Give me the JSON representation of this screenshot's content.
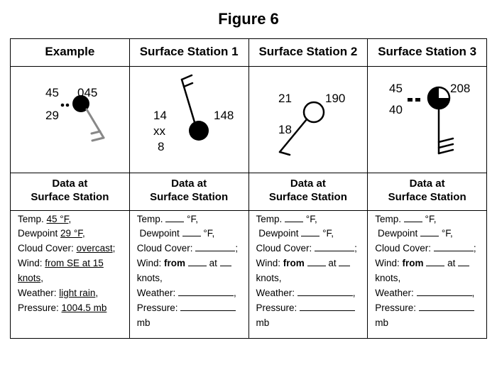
{
  "title": "Figure 6",
  "headers": [
    "Example",
    "Surface Station 1",
    "Surface Station 2",
    "Surface Station 3"
  ],
  "subhead": {
    "line1": "Data at",
    "line2": "Surface Station"
  },
  "example": {
    "model": {
      "temp": "45",
      "pressure_code": "045",
      "dewpoint": "29"
    },
    "data": {
      "temp": "45 °F",
      "dewpoint": "29 °F",
      "cloud": "overcast",
      "wind": "from SE at 15 knots",
      "weather": "light rain",
      "pressure": "1004.5 mb"
    }
  },
  "station1": {
    "model": {
      "left_top": "14",
      "left_mid": "xx",
      "left_bot": "8",
      "right": "148"
    }
  },
  "station2": {
    "model": {
      "temp": "21",
      "pressure_code": "190",
      "dewpoint": "18"
    }
  },
  "station3": {
    "model": {
      "temp": "45",
      "pressure_code": "208",
      "dewpoint": "40"
    }
  },
  "labels": {
    "temp": "Temp.",
    "temp_unit": "°F,",
    "dewpoint": "Dewpoint",
    "dew_unit": "°F,",
    "cloud": "Cloud Cover:",
    "wind_pre": "Wind:",
    "wind_from": "from",
    "wind_at": "at",
    "knots": "knots",
    "weather": "Weather:",
    "pressure": "Pressure:",
    "mb": "mb"
  }
}
